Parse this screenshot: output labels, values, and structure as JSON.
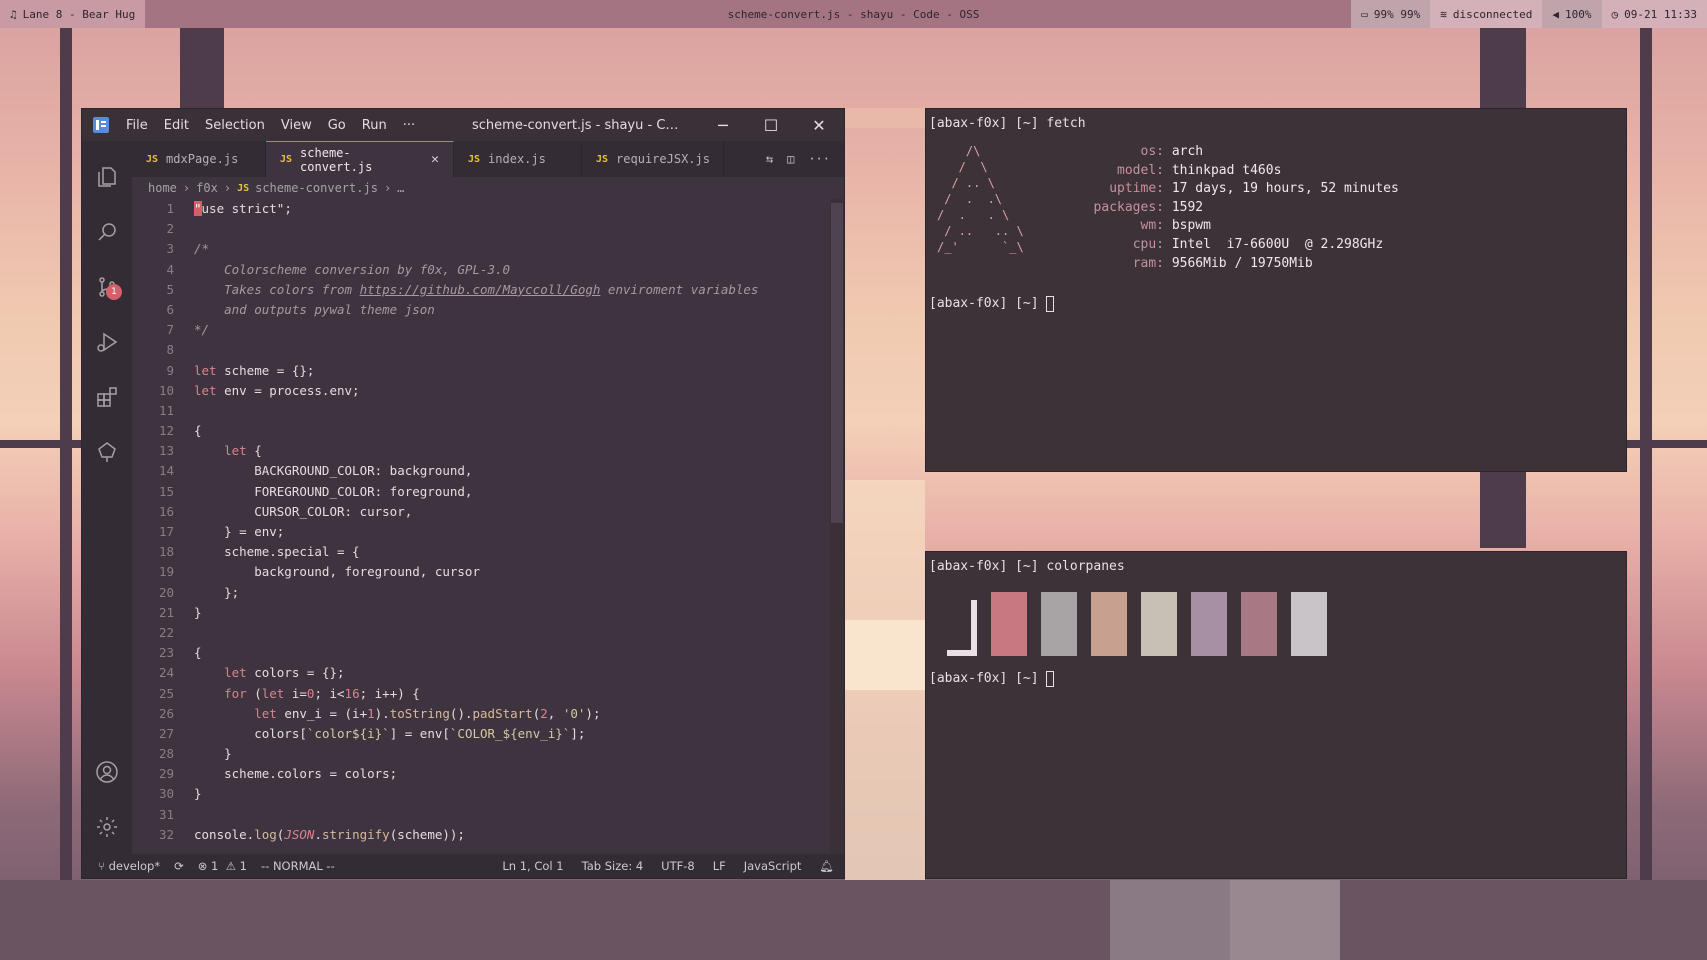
{
  "topbar": {
    "music": "Lane 8 - Bear Hug",
    "window_title": "scheme-convert.js - shayu - Code - OSS",
    "battery": "99% 99%",
    "network": "disconnected",
    "volume": "100%",
    "datetime": "09-21 11:33"
  },
  "editor": {
    "menu": [
      "File",
      "Edit",
      "Selection",
      "View",
      "Go",
      "Run",
      "···"
    ],
    "title": "scheme-convert.js - shayu - C…",
    "tabs": [
      {
        "label": "mdxPage.js",
        "badge": "JS"
      },
      {
        "label": "scheme-convert.js",
        "badge": "JS"
      },
      {
        "label": "index.js",
        "badge": "JS"
      },
      {
        "label": "requireJSX.js",
        "badge": "JS"
      }
    ],
    "breadcrumb": [
      "home",
      "f0x",
      "scheme-convert.js",
      "…"
    ],
    "scm_badge": "1",
    "line_numbers": [
      "1",
      "2",
      "3",
      "4",
      "5",
      "6",
      "7",
      "8",
      "9",
      "10",
      "11",
      "12",
      "13",
      "14",
      "15",
      "16",
      "17",
      "18",
      "19",
      "20",
      "21",
      "22",
      "23",
      "24",
      "25",
      "26",
      "27",
      "28",
      "29",
      "30",
      "31",
      "32"
    ],
    "status": {
      "branch": "develop*",
      "errors": "1",
      "warnings": "1",
      "mode": "-- NORMAL --",
      "position": "Ln 1, Col 1",
      "tab_size": "Tab Size: 4",
      "encoding": "UTF-8",
      "eol": "LF",
      "language": "JavaScript"
    }
  },
  "term_fetch": {
    "prompt": "[abax-f0x] [~] ",
    "command": "fetch",
    "ascii": "    /\\\n   /  \\\n  / .. \\\n /  .  .\\\n/  .   . \\\n / ..   .. \\\n/_'      `_\\",
    "info": [
      {
        "key": "os:",
        "value": "arch"
      },
      {
        "key": "model:",
        "value": "thinkpad t460s"
      },
      {
        "key": "uptime:",
        "value": "17 days, 19 hours, 52 minutes"
      },
      {
        "key": "packages:",
        "value": "1592"
      },
      {
        "key": "wm:",
        "value": "bspwm"
      },
      {
        "key": "cpu:",
        "value": "Intel  i7-6600U  @ 2.298GHz"
      },
      {
        "key": "ram:",
        "value": "9566Mib / 19750Mib"
      }
    ],
    "prompt2": "[abax-f0x] [~] "
  },
  "term_colors": {
    "prompt": "[abax-f0x] [~] ",
    "command": "colorpanes",
    "pane_colors": [
      "#c87880",
      "#a8a4a6",
      "#c8a090",
      "#c8c0b4",
      "#a890a4",
      "#a87884",
      "#c8c4c8"
    ],
    "prompt2": "[abax-f0x] [~] "
  },
  "colors": {
    "accent": "#d4707c",
    "editor_bg": "#3e3440",
    "terminal_bg": "#3c3238"
  }
}
